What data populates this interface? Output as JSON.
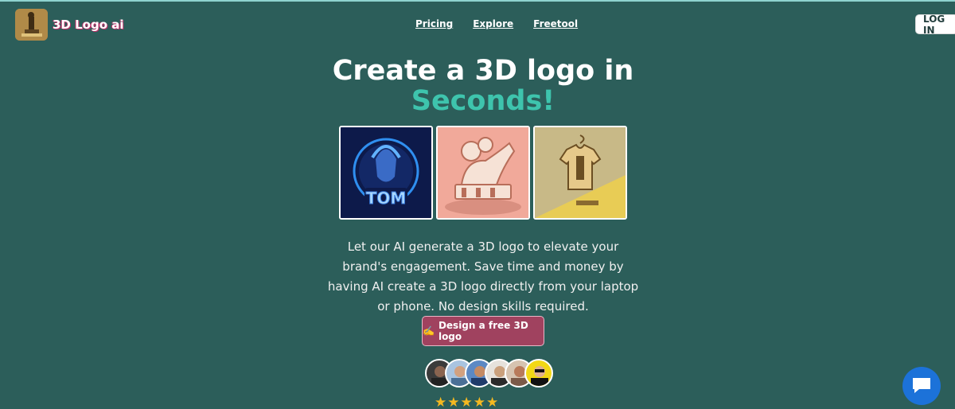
{
  "header": {
    "brand": "3D Logo ai",
    "nav": [
      "Pricing",
      "Explore",
      "Freetool"
    ],
    "login_label": "LOG IN"
  },
  "hero": {
    "title_line1": "Create a 3D logo in",
    "title_line2": "Seconds!",
    "description": "Let our AI generate a 3D logo to elevate your brand's engagement. Save time and money by having AI create a 3D logo directly from your laptop or phone. No design skills required.",
    "cta_icon": "✍️",
    "cta_label": "Design a free 3D logo",
    "gallery": [
      {
        "icon": "warrior-logo-image",
        "text": "TOM"
      },
      {
        "icon": "lion-logo-image"
      },
      {
        "icon": "tshirt-logo-image"
      }
    ],
    "rating": "★★★★★",
    "avatar_count": 6
  },
  "colors": {
    "background": "#2c5e5a",
    "accent": "#3ec4ad",
    "cta": "#a0425f",
    "chat": "#1c72d9"
  }
}
